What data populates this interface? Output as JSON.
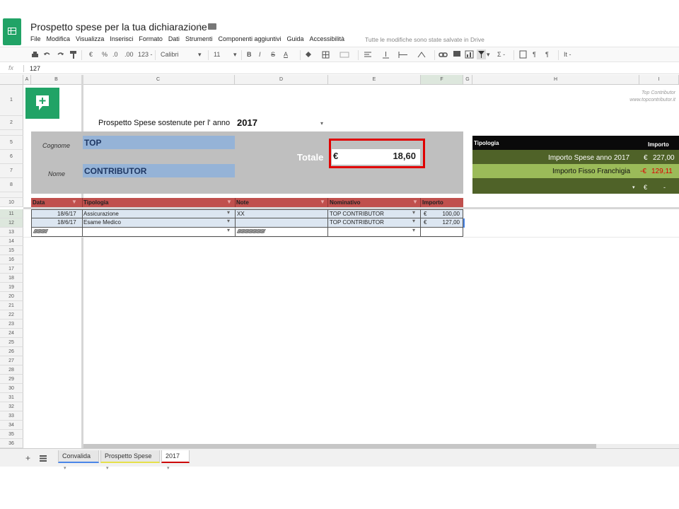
{
  "header": {
    "title": "Prospetto spese per la tua dichiarazione",
    "save_status": "Tutte le modifiche sono state salvate in Drive"
  },
  "menu": [
    "File",
    "Modifica",
    "Visualizza",
    "Inserisci",
    "Formato",
    "Dati",
    "Strumenti",
    "Componenti aggiuntivi",
    "Guida",
    "Accessibilità"
  ],
  "toolbar": {
    "currency": "€",
    "percent": "%",
    "dec_less": ".0",
    "dec_more": ".00",
    "format_more": "123 -",
    "font": "Calibri",
    "font_size": "11",
    "bold": "B",
    "italic": "I",
    "strike": "S",
    "textcolor": "A",
    "sigma": "Σ -",
    "lang": "It -"
  },
  "formula_bar": {
    "fx": "fx",
    "value": "127"
  },
  "columns": [
    "A",
    "B",
    "C",
    "D",
    "E",
    "F",
    "G",
    "H",
    "I"
  ],
  "rows": [
    "1",
    "2",
    "",
    "5",
    "6",
    "7",
    "8",
    "",
    "10",
    "11",
    "12",
    "13",
    "14",
    "15",
    "16",
    "17",
    "18",
    "19",
    "20",
    "21",
    "22",
    "23",
    "24",
    "25",
    "26",
    "27",
    "28",
    "29",
    "30",
    "31",
    "32",
    "33",
    "34",
    "35",
    "36"
  ],
  "sheet": {
    "heading": "Prospetto Spese sostenute per l' anno",
    "year": "2017",
    "cognome_label": "Cognome",
    "cognome_value": "TOP",
    "nome_label": "Nome",
    "nome_value": "CONTRIBUTOR",
    "totale_label": "Totale",
    "totale_currency": "€",
    "totale_value": "18,60",
    "watermark1": "Top Contributor",
    "watermark2": "www.topcontributor.it",
    "table_headers": [
      "Data",
      "Tipologia",
      "Note",
      "Nominativo",
      "Importo"
    ],
    "table_rows": [
      {
        "data": "18/6/17",
        "tipologia": "Assicurazione",
        "note": "XX",
        "nominativo": "TOP CONTRIBUTOR",
        "currency": "€",
        "importo": "100,00"
      },
      {
        "data": "18/6/17",
        "tipologia": "Esame Medico",
        "note": "",
        "nominativo": "TOP CONTRIBUTOR",
        "currency": "€",
        "importo": "127,00"
      },
      {
        "data": "////////////////",
        "tipologia": "",
        "note": "////////////////////////////////",
        "nominativo": "",
        "currency": "",
        "importo": ""
      }
    ],
    "summary": {
      "header_tipologia": "Tipologia",
      "header_importo": "Importo",
      "row1_label": "Importo Spese anno 2017",
      "row1_currency": "€",
      "row1_value": "227,00",
      "row2_label": "Importo Fisso Franchigia",
      "row2_currency": "-€",
      "row2_value": "129,11",
      "row3_currency": "€",
      "row3_value": "-"
    }
  },
  "tabs": [
    {
      "label": "Convalida",
      "color": "#4a86e8"
    },
    {
      "label": "Prospetto Spese",
      "color": "#e6e04a"
    },
    {
      "label": "2017",
      "color": "#cc0000"
    }
  ],
  "colors": {
    "app_green": "#21a366",
    "header_red": "#c0504d",
    "highlight_border": "#e00000",
    "summary_dark": "#0a0a0a",
    "summary_green": "#4f6228",
    "summary_light": "#9bbb59",
    "gray_block": "#bfbfbf",
    "blue_field": "#95b3d7"
  }
}
